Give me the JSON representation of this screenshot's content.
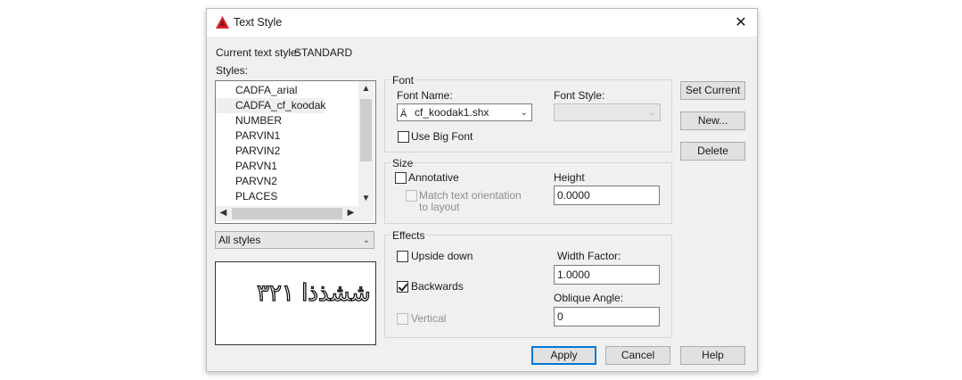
{
  "window": {
    "title": "Text Style",
    "close": "✕"
  },
  "current_style": {
    "label": "Current text style:",
    "value": "STANDARD"
  },
  "styles": {
    "label": "Styles:",
    "items": [
      "CADFA_arial",
      "CADFA_cf_koodak",
      "NUMBER",
      "PARVIN1",
      "PARVIN2",
      "PARVN1",
      "PARVN2",
      "PLACES"
    ],
    "selected": "CADFA_cf_koodak"
  },
  "filter": {
    "value": "All styles"
  },
  "preview": {
    "text": "ششذذا ۳۲۱"
  },
  "font": {
    "group_label": "Font",
    "font_name_label": "Font Name:",
    "font_name_value": "cf_koodak1.shx",
    "font_style_label": "Font Style:",
    "font_style_value": "",
    "big_font_label": "Use Big Font",
    "big_font_checked": false
  },
  "size": {
    "group_label": "Size",
    "annotative_label": "Annotative",
    "match_label_line1": "Match text orientation",
    "match_label_line2": "to layout",
    "height_label": "Height",
    "height_value": "0.0000"
  },
  "effects": {
    "group_label": "Effects",
    "upside_down_label": "Upside down",
    "backwards_label": "Backwards",
    "backwards_checked": true,
    "vertical_label": "Vertical",
    "width_factor_label": "Width Factor:",
    "width_factor_value": "1.0000",
    "oblique_label": "Oblique Angle:",
    "oblique_value": "0"
  },
  "buttons": {
    "set_current": "Set Current",
    "new": "New...",
    "delete": "Delete",
    "apply": "Apply",
    "cancel": "Cancel",
    "help": "Help"
  },
  "colors": {
    "app_icon": "#d8232a",
    "default_button_border": "#0078d7"
  }
}
